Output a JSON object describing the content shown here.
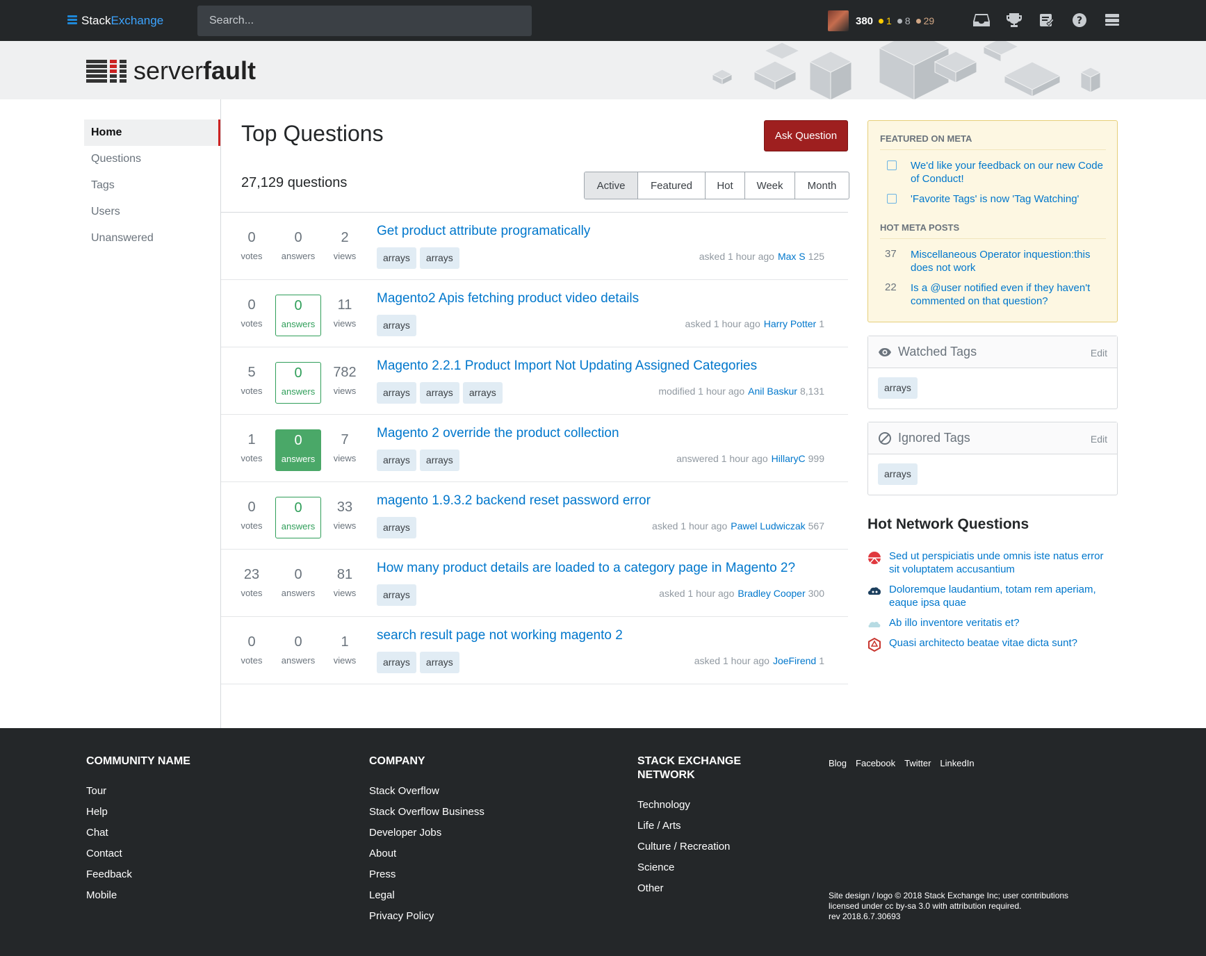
{
  "topbar": {
    "brand_part1": "Stack",
    "brand_part2": "Exchange",
    "search_placeholder": "Search...",
    "reputation": "380",
    "gold": "1",
    "silver": "8",
    "bronze": "29"
  },
  "site": {
    "logo_light": "server",
    "logo_bold": "fault"
  },
  "nav": {
    "home": "Home",
    "questions": "Questions",
    "tags": "Tags",
    "users": "Users",
    "unanswered": "Unanswered"
  },
  "main": {
    "title": "Top Questions",
    "ask_button": "Ask Question",
    "count": "27,129 questions",
    "tabs": [
      "Active",
      "Featured",
      "Hot",
      "Week",
      "Month"
    ]
  },
  "questions": [
    {
      "votes": "0",
      "answers": "0",
      "views": "2",
      "title": "Get product attribute programatically",
      "tags": [
        "arrays",
        "arrays"
      ],
      "action": "asked 1 hour ago",
      "user": "Max S",
      "rep": "125"
    },
    {
      "votes": "0",
      "answers": "0",
      "views": "11",
      "title": "Magento2 Apis fetching product video details",
      "tags": [
        "arrays"
      ],
      "action": "asked 1 hour ago",
      "user": "Harry Potter",
      "rep": "1"
    },
    {
      "votes": "5",
      "answers": "0",
      "views": "782",
      "title": "Magento 2.2.1 Product Import Not Updating Assigned Categories",
      "tags": [
        "arrays",
        "arrays",
        "arrays"
      ],
      "action": "modified 1 hour ago",
      "user": "Anil Baskur",
      "rep": "8,131"
    },
    {
      "votes": "1",
      "answers": "0",
      "views": "7",
      "title": "Magento 2 override the product collection",
      "tags": [
        "arrays",
        "arrays"
      ],
      "action": "answered 1 hour ago",
      "user": "HillaryC",
      "rep": "999"
    },
    {
      "votes": "0",
      "answers": "0",
      "views": "33",
      "title": "magento 1.9.3.2 backend reset password error",
      "tags": [
        "arrays"
      ],
      "action": "asked 1 hour ago",
      "user": "Pawel Ludwiczak",
      "rep": "567"
    },
    {
      "votes": "23",
      "answers": "0",
      "views": "81",
      "title": "How many product details are loaded to a category page in Magento 2?",
      "tags": [
        "arrays"
      ],
      "action": "asked 1 hour ago",
      "user": "Bradley Cooper",
      "rep": "300"
    },
    {
      "votes": "0",
      "answers": "0",
      "views": "1",
      "title": "search result page not working magento 2",
      "tags": [
        "arrays",
        "arrays"
      ],
      "action": "asked 1 hour ago",
      "user": "JoeFirend",
      "rep": "1"
    }
  ],
  "labels": {
    "votes": "votes",
    "answers": "answers",
    "views": "views"
  },
  "sidebar": {
    "featured_heading": "FEATURED ON META",
    "featured": [
      "We'd like your feedback on our new Code of Conduct!",
      "'Favorite Tags' is now 'Tag Watching'"
    ],
    "hot_meta_heading": "HOT META POSTS",
    "hot_meta": [
      {
        "num": "37",
        "text": "Miscellaneous Operator inquestion:this does not work"
      },
      {
        "num": "22",
        "text": "Is a @user notified even if they haven't commented on that question?"
      }
    ],
    "watched": {
      "title": "Watched Tags",
      "edit": "Edit",
      "tag": "arrays"
    },
    "ignored": {
      "title": "Ignored Tags",
      "edit": "Edit",
      "tag": "arrays"
    },
    "hnq_title": "Hot Network Questions",
    "hnq": [
      "Sed ut perspiciatis unde omnis iste natus error sit voluptatem accusantium",
      "Doloremque laudantium, totam rem aperiam, eaque ipsa quae",
      "Ab illo inventore veritatis et?",
      "Quasi architecto beatae vitae dicta sunt?"
    ]
  },
  "footer": {
    "col1": {
      "title": "COMMUNITY NAME",
      "links": [
        "Tour",
        "Help",
        "Chat",
        "Contact",
        "Feedback",
        "Mobile"
      ]
    },
    "col2": {
      "title": "COMPANY",
      "links": [
        "Stack Overflow",
        "Stack Overflow Business",
        "Developer Jobs",
        "About",
        "Press",
        "Legal",
        "Privacy Policy"
      ]
    },
    "col3": {
      "title": "STACK EXCHANGE NETWORK",
      "links": [
        "Technology",
        "Life / Arts",
        "Culture / Recreation",
        "Science",
        "Other"
      ]
    },
    "social": [
      "Blog",
      "Facebook",
      "Twitter",
      "LinkedIn"
    ],
    "copyright": [
      "Site design / logo © 2018 Stack Exchange Inc; user contributions",
      "licensed under cc by-sa 3.0 with attribution required.",
      "rev 2018.6.7.30693"
    ]
  },
  "colors": {
    "accent": "#9e1f1f",
    "link": "#0077cc",
    "answered": "#4aa868"
  }
}
